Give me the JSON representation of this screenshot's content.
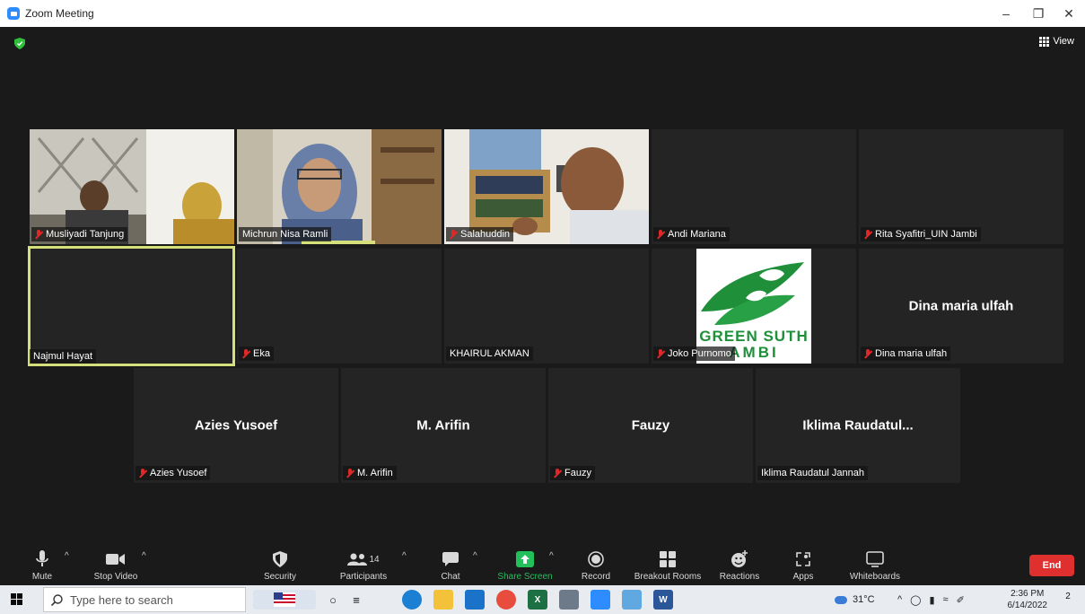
{
  "window": {
    "title": "Zoom Meeting"
  },
  "meeting": {
    "view_label": "View"
  },
  "tiles": [
    {
      "id": "musliyadi",
      "name": "Musliyadi Tanjung",
      "muted": true
    },
    {
      "id": "michrun",
      "name": "Michrun Nisa Ramli",
      "muted": false
    },
    {
      "id": "salahuddin",
      "name": "Salahuddin",
      "muted": true
    },
    {
      "id": "andi",
      "name": "Andi Mariana",
      "muted": true
    },
    {
      "id": "rita",
      "name": "Rita Syafitri_UIN Jambi",
      "muted": true
    },
    {
      "id": "najmul",
      "name": "Najmul Hayat",
      "muted": false,
      "active": true
    },
    {
      "id": "eka",
      "name": "Eka",
      "muted": true
    },
    {
      "id": "khairul",
      "name": "KHAIRUL AKMAN",
      "muted": false
    },
    {
      "id": "joko",
      "name": "Joko Purnomo",
      "muted": true,
      "logo_text_1": "GREEN SUTH",
      "logo_text_2": "AMBI"
    },
    {
      "id": "dina",
      "name": "Dina maria ulfah",
      "center_name": "Dina maria ulfah",
      "muted": true
    },
    {
      "id": "azies",
      "name": "Azies Yusoef",
      "center_name": "Azies Yusoef",
      "muted": true
    },
    {
      "id": "arifin",
      "name": "M. Arifin",
      "center_name": "M. Arifin",
      "muted": true
    },
    {
      "id": "fauzy",
      "name": "Fauzy",
      "center_name": "Fauzy",
      "muted": true
    },
    {
      "id": "iklima",
      "name": "Iklima Raudatul Jannah",
      "center_name": "Iklima  Raudatul...",
      "muted": false
    }
  ],
  "toolbar": {
    "mute": "Mute",
    "stop_video": "Stop Video",
    "security": "Security",
    "participants": "Participants",
    "participants_count": "14",
    "chat": "Chat",
    "share_screen": "Share Screen",
    "record": "Record",
    "breakout_rooms": "Breakout Rooms",
    "reactions": "Reactions",
    "apps": "Apps",
    "whiteboards": "Whiteboards",
    "end": "End"
  },
  "taskbar": {
    "search_placeholder": "Type here to search",
    "temperature": "31°C",
    "time": "2:36 PM",
    "date": "6/14/2022",
    "notifications": "2"
  },
  "colors": {
    "zoom_blue": "#2d8cff",
    "end_red": "#e02f2f",
    "share_green": "#22c05a",
    "active_speaker": "#d6e07a"
  }
}
